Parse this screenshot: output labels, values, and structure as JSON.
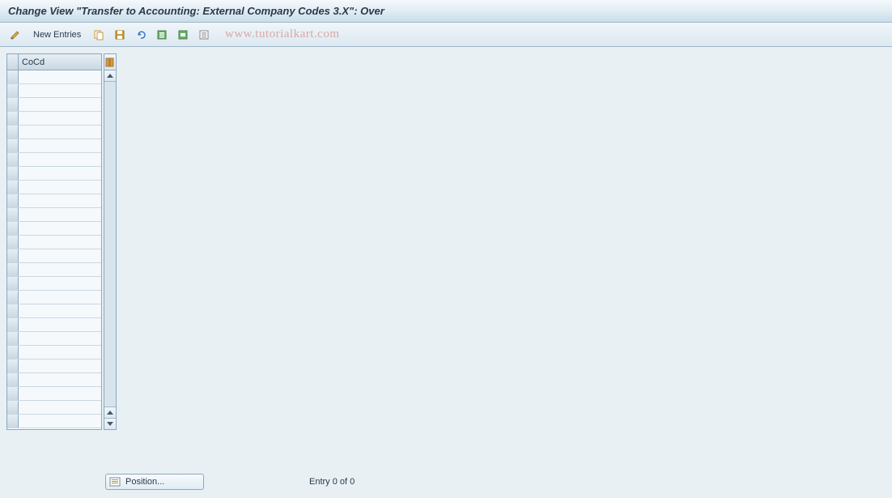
{
  "title": "Change View \"Transfer to Accounting: External Company Codes 3.X\": Over",
  "toolbar": {
    "new_entries_label": "New Entries"
  },
  "watermark": "www.tutorialkart.com",
  "table": {
    "column_header": "CoCd",
    "rows": [
      "",
      "",
      "",
      "",
      "",
      "",
      "",
      "",
      "",
      "",
      "",
      "",
      "",
      "",
      "",
      "",
      "",
      "",
      "",
      "",
      "",
      "",
      "",
      "",
      "",
      ""
    ]
  },
  "footer": {
    "position_label": "Position...",
    "entry_text": "Entry 0 of 0"
  },
  "icons": {
    "edit": "edit-icon",
    "copy": "copy-icon",
    "save": "save-icon",
    "undo": "undo-icon",
    "select_all": "select-all-icon",
    "select_block": "select-block-icon",
    "deselect": "deselect-icon",
    "config": "config-icon",
    "position": "position-icon"
  }
}
